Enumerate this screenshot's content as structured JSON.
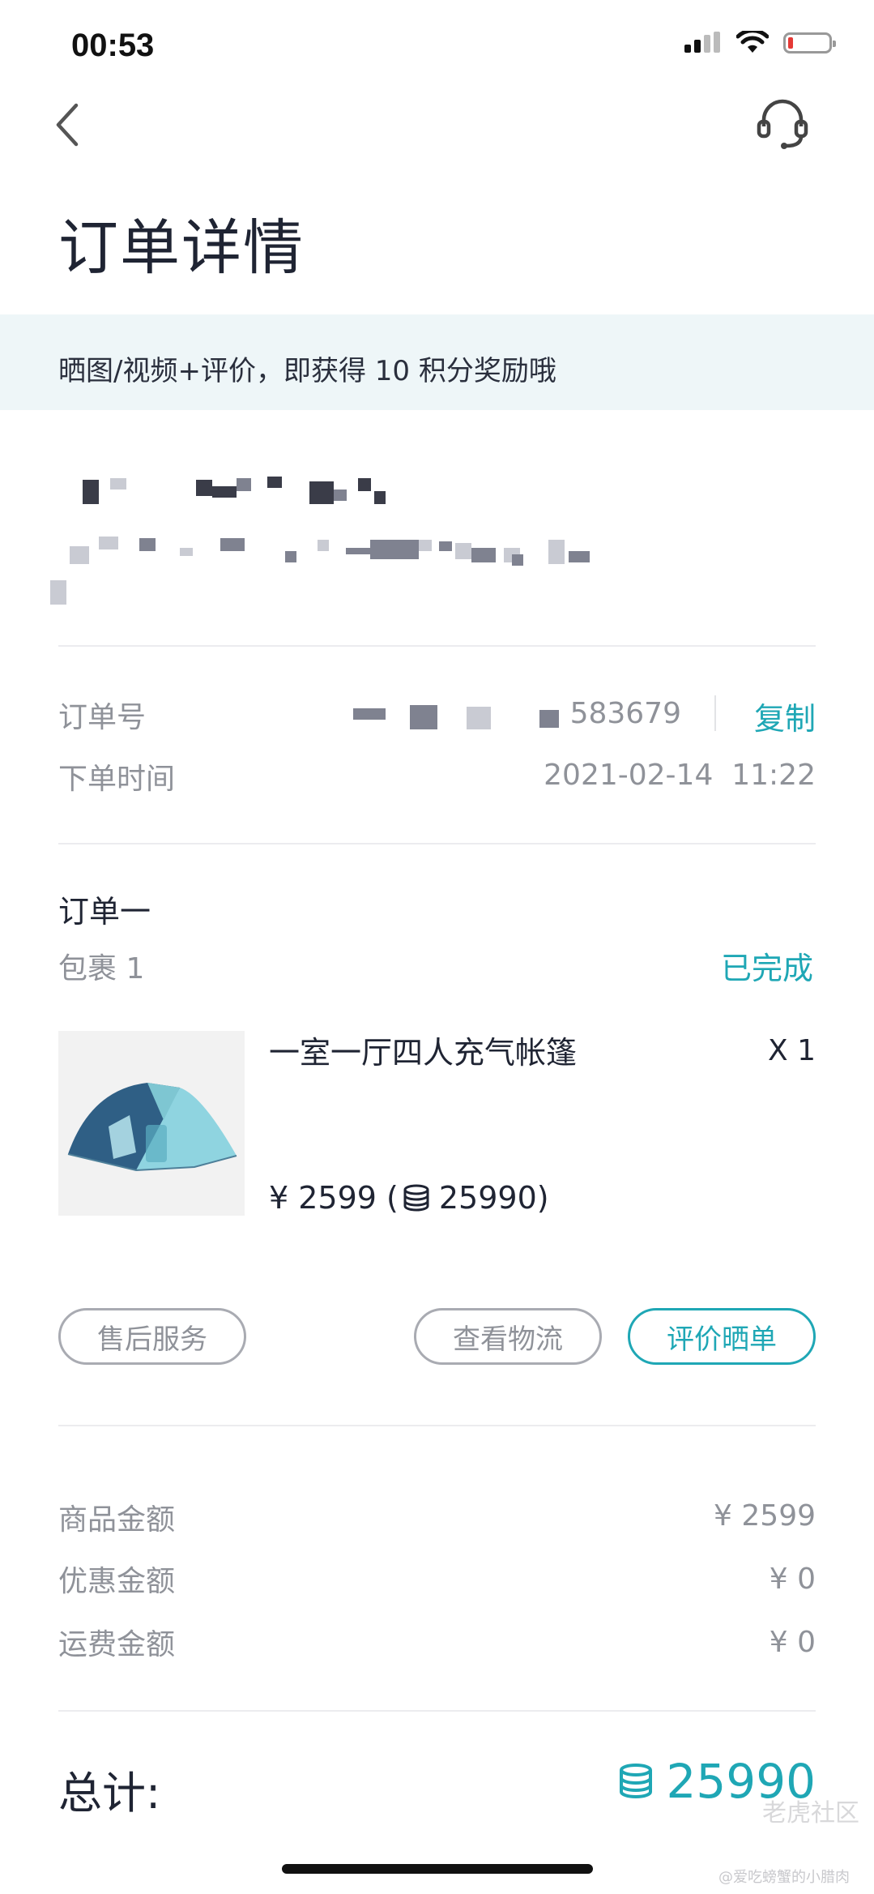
{
  "status_bar": {
    "time": "00:53"
  },
  "header": {
    "title": "订单详情"
  },
  "banner": {
    "text": "晒图/视频+评价，即获得 10 积分奖励哦"
  },
  "order_info": {
    "order_no_label": "订单号",
    "order_no_value": "583679",
    "copy_label": "复制",
    "time_label": "下单时间",
    "time_value": "2021-02-14  11:22"
  },
  "order": {
    "section_title": "订单一",
    "package_label": "包裹 1",
    "package_status": "已完成",
    "product": {
      "name": "一室一厅四人充气帐篷",
      "qty": "X 1",
      "price": "¥ 2599 (",
      "points": "25990)",
      "icon": "coin-stack-icon"
    },
    "actions": {
      "after_sales": "售后服务",
      "logistics": "查看物流",
      "review": "评价晒单"
    }
  },
  "amounts": {
    "goods_label": "商品金额",
    "goods_value": "¥ 2599",
    "discount_label": "优惠金额",
    "discount_value": "¥ 0",
    "shipping_label": "运费金额",
    "shipping_value": "¥ 0"
  },
  "total": {
    "label": "总计:",
    "value": "25990"
  },
  "watermark": {
    "main": "老虎社区",
    "sub": "@爱吃螃蟹的小腊肉"
  },
  "colors": {
    "accent": "#1fa7b5",
    "banner_bg": "#eef6f8",
    "text": "#1f2433",
    "muted": "#8f9299"
  }
}
